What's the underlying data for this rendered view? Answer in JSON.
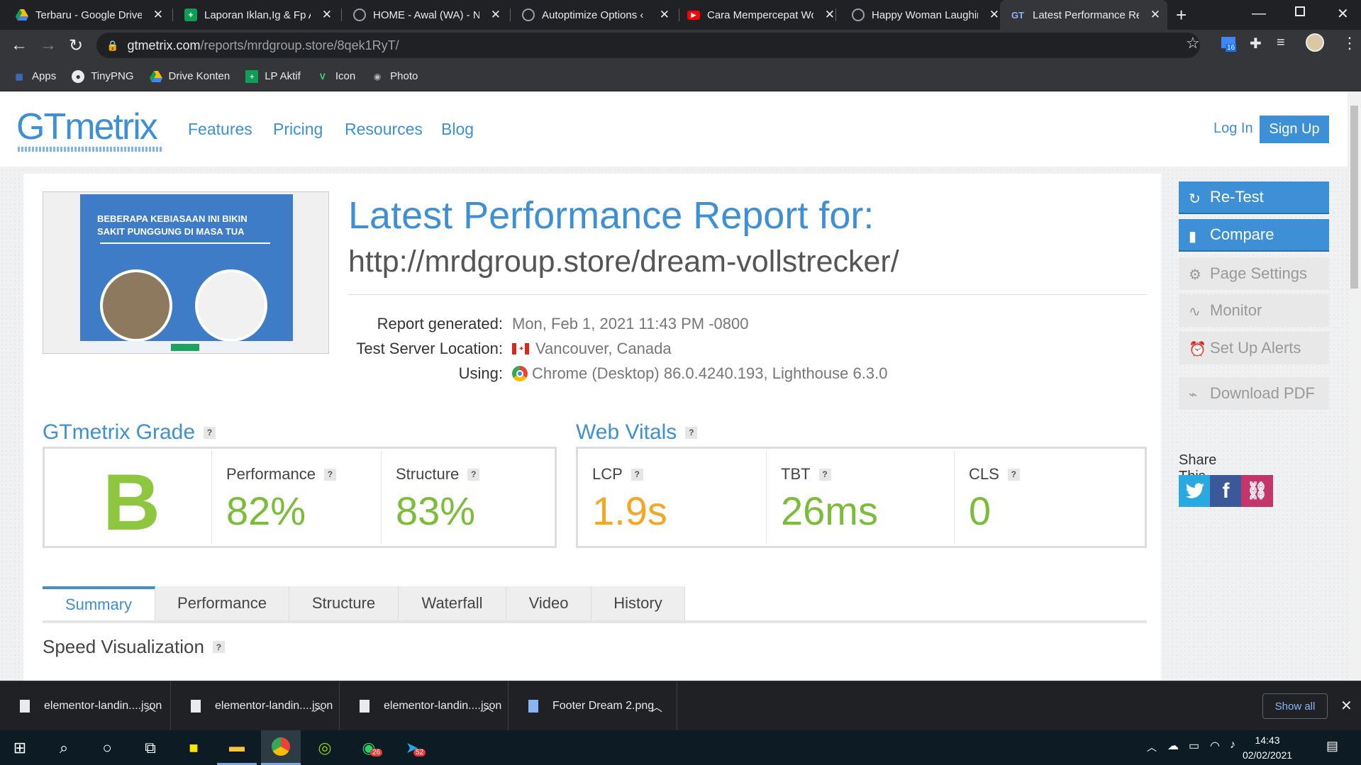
{
  "browser": {
    "tabs": [
      {
        "title": "Terbaru - Google Drive",
        "icon": "google-drive-icon"
      },
      {
        "title": "Laporan Iklan,Ig & Fp A",
        "icon": "google-sheets-icon"
      },
      {
        "title": "HOME - Awal (WA) - N",
        "icon": "globe-icon"
      },
      {
        "title": "Autoptimize Options ‹",
        "icon": "globe-icon"
      },
      {
        "title": "Cara Mempercepat Wo",
        "icon": "youtube-icon"
      },
      {
        "title": "Happy Woman Laughin",
        "icon": "globe-icon"
      },
      {
        "title": "Latest Performance Rep",
        "icon": "gtmetrix-icon"
      }
    ],
    "url_host": "gtmetrix.com",
    "url_path": "/reports/mrdgroup.store/8qek1RyT/",
    "bookmarks": [
      {
        "label": "Apps",
        "icon": "apps-grid-icon"
      },
      {
        "label": "TinyPNG",
        "icon": "panda-icon"
      },
      {
        "label": "Drive Konten",
        "icon": "google-drive-icon"
      },
      {
        "label": "LP Aktif",
        "icon": "google-sheets-icon"
      },
      {
        "label": "Icon",
        "icon": "vector-icon"
      },
      {
        "label": "Photo",
        "icon": "camera-icon"
      }
    ],
    "ext_badge": "16"
  },
  "site": {
    "logo": "GTmetrix",
    "nav": [
      "Features",
      "Pricing",
      "Resources",
      "Blog"
    ],
    "login": "Log In",
    "signup": "Sign Up"
  },
  "report": {
    "thumb_text": "BEBERAPA KEBIASAAN INI BIKIN SAKIT PUNGGUNG DI MASA TUA",
    "title": "Latest Performance Report for:",
    "url": "http://mrdgroup.store/dream-vollstrecker/",
    "meta": [
      {
        "label": "Report generated:",
        "value": "Mon, Feb 1, 2021 11:43 PM -0800"
      },
      {
        "label": "Test Server Location:",
        "value": "Vancouver, Canada"
      },
      {
        "label": "Using:",
        "value": "Chrome (Desktop) 86.0.4240.193, Lighthouse 6.3.0"
      }
    ],
    "grade_title": "GTmetrix Grade",
    "grade": "B",
    "performance_label": "Performance",
    "performance": "82%",
    "structure_label": "Structure",
    "structure": "83%",
    "vitals_title": "Web Vitals",
    "lcp_label": "LCP",
    "lcp": "1.9s",
    "tbt_label": "TBT",
    "tbt": "26ms",
    "cls_label": "CLS",
    "cls": "0",
    "help": "?",
    "tabs": [
      "Summary",
      "Performance",
      "Structure",
      "Waterfall",
      "Video",
      "History"
    ],
    "speed_title": "Speed Visualization",
    "colors": {
      "accent": "#3d8fd6",
      "good": "#7bbd3a",
      "warn": "#f5a623"
    }
  },
  "sidebar": {
    "retest": "Re-Test",
    "compare": "Compare",
    "page_settings": "Page Settings",
    "monitor": "Monitor",
    "alerts": "Set Up Alerts",
    "pdf": "Download PDF",
    "share": "Share This Report"
  },
  "downloads": [
    {
      "name": "elementor-landin....json"
    },
    {
      "name": "elementor-landin....json"
    },
    {
      "name": "elementor-landin....json"
    },
    {
      "name": "Footer Dream 2.png"
    }
  ],
  "show_all": "Show all",
  "taskbar": {
    "time": "14:43",
    "date": "02/02/2021",
    "whatsapp_badge": "26",
    "telegram_badge": "52"
  }
}
